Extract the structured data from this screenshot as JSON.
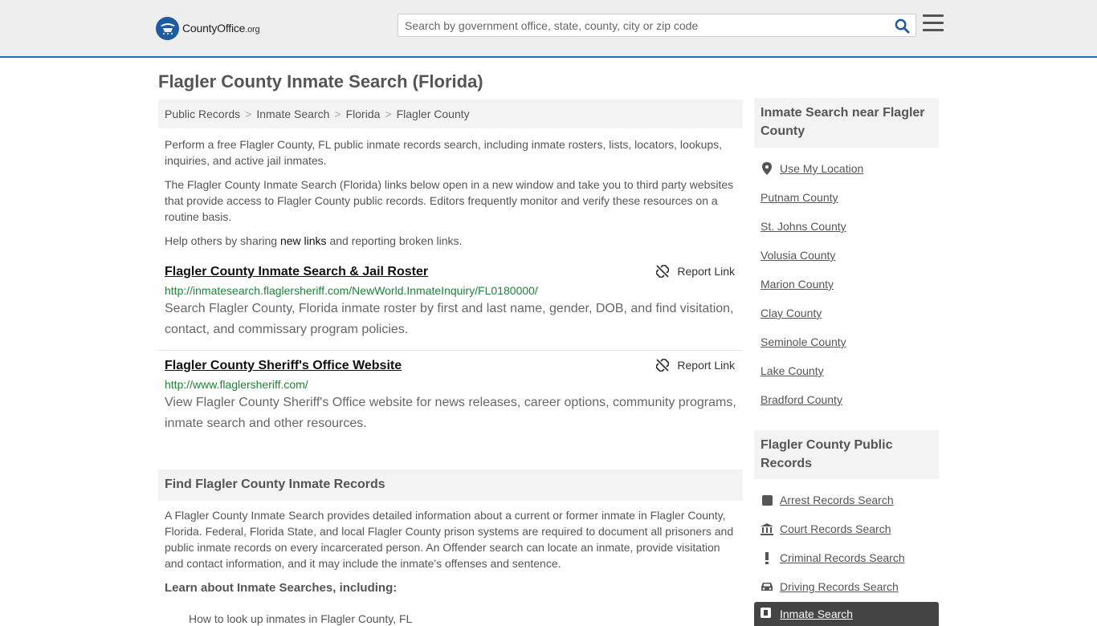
{
  "header": {
    "logo_text_main": "CountyOffice",
    "logo_text_suffix": ".org",
    "search_placeholder": "Search by government office, state, county, city or zip code"
  },
  "page_title": "Flagler County Inmate Search (Florida)",
  "breadcrumb": [
    "Public Records",
    "Inmate Search",
    "Florida",
    "Flagler County"
  ],
  "intro": {
    "p1": "Perform a free Flagler County, FL public inmate records search, including inmate rosters, lists, locators, lookups, inquiries, and active jail inmates.",
    "p2": "The Flagler County Inmate Search (Florida) links below open in a new window and take you to third party websites that provide access to Flagler County public records. Editors frequently monitor and verify these resources on a routine basis.",
    "p3_before": "Help others by sharing ",
    "p3_link": "new links",
    "p3_after": " and reporting broken links."
  },
  "results": [
    {
      "title": "Flagler County Inmate Search & Jail Roster",
      "url": "http://inmatesearch.flaglersheriff.com/NewWorld.InmateInquiry/FL0180000/",
      "description": "Search Flagler County, Florida inmate roster by first and last name, gender, DOB, and find visitation, contact, and commissary program policies.",
      "report_label": "Report Link"
    },
    {
      "title": "Flagler County Sheriff's Office Website",
      "url": "http://www.flaglersheriff.com/",
      "description": "View Flagler County Sheriff's Office website for news releases, career options, community programs, inmate search and other resources.",
      "report_label": "Report Link"
    }
  ],
  "find_section": {
    "heading": "Find Flagler County Inmate Records",
    "body": "A Flagler County Inmate Search provides detailed information about a current or former inmate in Flagler County, Florida. Federal, Florida State, and local Flagler County prison systems are required to document all prisoners and public inmate records on every incarcerated person. An Offender search can locate an inmate, provide visitation and contact information, and it may include the inmate's offenses and sentence.",
    "learn_heading": "Learn about Inmate Searches, including:",
    "clipped_item": "How to look up inmates in Flagler County, FL"
  },
  "sidebar": {
    "nearby_heading": "Inmate Search near Flagler County",
    "use_location": "Use My Location",
    "nearby": [
      "Putnam County",
      "St. Johns County",
      "Volusia County",
      "Marion County",
      "Clay County",
      "Seminole County",
      "Lake County",
      "Bradford County"
    ],
    "records_heading": "Flagler County Public Records",
    "records": [
      {
        "label": "Arrest Records Search",
        "icon": "square-icon"
      },
      {
        "label": "Court Records Search",
        "icon": "courthouse-icon"
      },
      {
        "label": "Criminal Records Search",
        "icon": "exclamation-icon"
      },
      {
        "label": "Driving Records Search",
        "icon": "car-icon"
      }
    ],
    "active_item": "Inmate Search"
  },
  "colors": {
    "accent_blue": "#2b6cb0",
    "url_green": "#218139",
    "panel_gray": "#f3f3f3"
  }
}
